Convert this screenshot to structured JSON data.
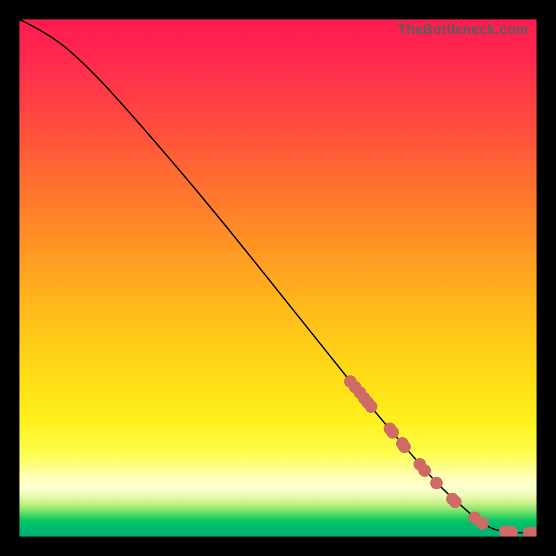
{
  "watermark": "TheBottleneck.com",
  "colors": {
    "marker": "#cf6a66",
    "curve": "#000000",
    "background_black": "#000000"
  },
  "gradient_stops": [
    {
      "pct": 0.0,
      "color": "#ff1a51"
    },
    {
      "pct": 0.08,
      "color": "#ff2a4d"
    },
    {
      "pct": 0.18,
      "color": "#ff4540"
    },
    {
      "pct": 0.3,
      "color": "#ff6a32"
    },
    {
      "pct": 0.42,
      "color": "#ff8f26"
    },
    {
      "pct": 0.54,
      "color": "#ffb41c"
    },
    {
      "pct": 0.64,
      "color": "#ffd017"
    },
    {
      "pct": 0.72,
      "color": "#ffe417"
    },
    {
      "pct": 0.78,
      "color": "#fef21f"
    },
    {
      "pct": 0.84,
      "color": "#fdfd4f"
    },
    {
      "pct": 0.885,
      "color": "#ffffb7"
    },
    {
      "pct": 0.905,
      "color": "#fdffd0"
    },
    {
      "pct": 0.922,
      "color": "#eafbb1"
    },
    {
      "pct": 0.936,
      "color": "#c4f186"
    },
    {
      "pct": 0.95,
      "color": "#7de36b"
    },
    {
      "pct": 0.962,
      "color": "#2fd162"
    },
    {
      "pct": 0.972,
      "color": "#00c46a"
    },
    {
      "pct": 0.986,
      "color": "#00b971"
    },
    {
      "pct": 1.0,
      "color": "#00b176"
    }
  ],
  "chart_data": {
    "type": "line",
    "title": "",
    "xlabel": "",
    "ylabel": "",
    "xlim": [
      0,
      100
    ],
    "ylim": [
      0,
      100
    ],
    "series": [
      {
        "name": "curve",
        "x": [
          0,
          3,
          8,
          14,
          20,
          30,
          40,
          50,
          60,
          68,
          74,
          78,
          82,
          86,
          88.5,
          90.5,
          92,
          94,
          96,
          98,
          100
        ],
        "y": [
          100,
          98.5,
          95.5,
          90,
          83.5,
          72,
          60,
          47.5,
          35,
          25,
          18,
          13.3,
          9,
          5.5,
          3.2,
          2.0,
          1.3,
          0.9,
          0.75,
          0.7,
          0.7
        ]
      },
      {
        "name": "markers",
        "x": [
          64.0,
          64.9,
          65.8,
          66.7,
          67.3,
          68.0,
          71.6,
          72.2,
          74.0,
          74.5,
          77.4,
          78.4,
          80.6,
          83.7,
          84.3,
          88.0,
          89.5,
          94.0,
          95.2,
          98.5,
          99.5
        ],
        "y": [
          30.0,
          28.9,
          27.8,
          26.7,
          26.0,
          25.1,
          20.9,
          20.1,
          18.0,
          17.4,
          14.0,
          12.8,
          10.4,
          7.3,
          6.7,
          3.6,
          2.6,
          0.88,
          0.8,
          0.7,
          0.7
        ]
      }
    ]
  }
}
